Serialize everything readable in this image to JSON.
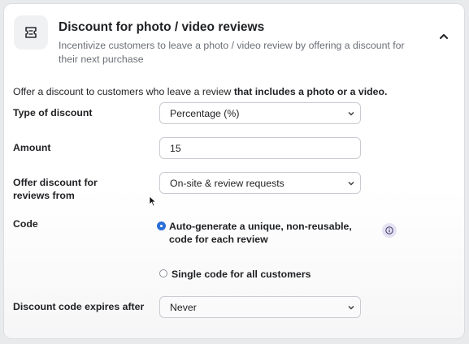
{
  "header": {
    "icon": "ticket-icon",
    "title": "Discount for photo / video reviews",
    "subtitle": "Incentivize customers to leave a photo / video review by offering a discount for their next purchase",
    "collapse_icon": "chevron-up-icon"
  },
  "intro": {
    "text": "Offer a discount to customers who leave a review ",
    "bold": "that includes a photo or a video."
  },
  "fields": {
    "type_label": "Type of discount",
    "type_value": "Percentage (%)",
    "amount_label": "Amount",
    "amount_value": "15",
    "reviews_from_label": "Offer discount for reviews from",
    "reviews_from_value": "On-site & review requests",
    "code_label": "Code",
    "code_option_1": "Auto-generate a unique, non-reusable, code for each review",
    "code_option_2": "Single code for all customers",
    "code_selected": "Auto-generate a unique, non-reusable, code for each review",
    "expires_label": "Discount code expires after",
    "expires_value": "Never"
  },
  "colors": {
    "accent": "#2b6fd6",
    "info_badge": "#e4e2f2"
  }
}
